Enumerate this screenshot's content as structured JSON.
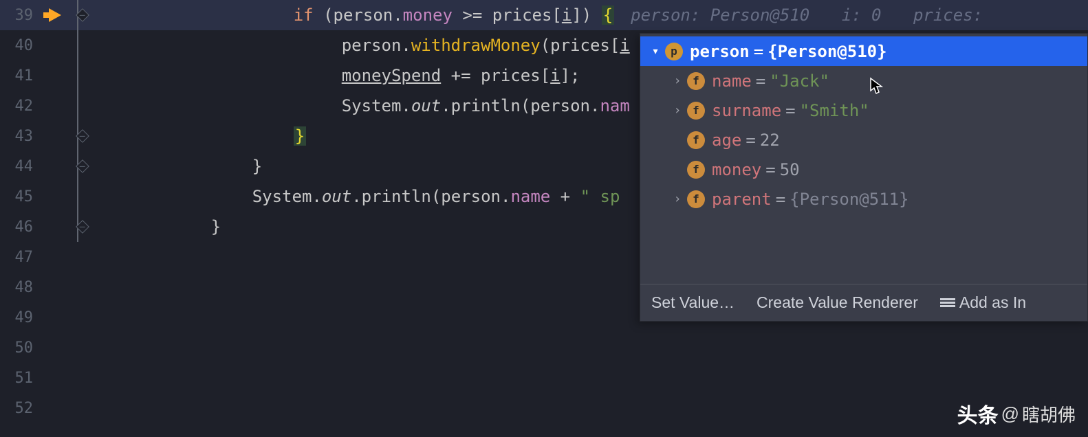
{
  "gutter": {
    "line39": "39",
    "line40": "40",
    "line41": "41",
    "line42": "42",
    "line43": "43",
    "line44": "44",
    "line45": "45",
    "line46": "46",
    "line47": "47",
    "line48": "48",
    "line49": "49",
    "line50": "50",
    "line51": "51",
    "line52": "52"
  },
  "code": {
    "l39_if": "if ",
    "l39_lpar": "(",
    "l39_person": "person",
    "l39_dot": ".",
    "l39_money": "money",
    "l39_op": " >= ",
    "l39_prices": "prices",
    "l39_lb": "[",
    "l39_i": "i",
    "l39_rb": "]) ",
    "l39_brace": "{",
    "l40_person": "person",
    "l40_dot": ".",
    "l40_call": "withdrawMoney",
    "l40_lpar": "(",
    "l40_prices": "prices",
    "l40_lb": "[",
    "l40_i": "i",
    "l41_moneySpend": "moneySpend",
    "l41_op": " += ",
    "l41_prices": "prices",
    "l41_lb": "[",
    "l41_i": "i",
    "l41_rb": "];",
    "l42_system": "System",
    "l42_dot1": ".",
    "l42_out": "out",
    "l42_dot2": ".",
    "l42_println": "println",
    "l42_lpar": "(",
    "l42_person": "person",
    "l42_dot3": ".",
    "l42_nam": "nam",
    "l43_brace": "}",
    "l44_brace": "}",
    "l45_system": "System",
    "l45_dot1": ".",
    "l45_out": "out",
    "l45_dot2": ".",
    "l45_println": "println",
    "l45_lpar": "(",
    "l45_person": "person",
    "l45_dot3": ".",
    "l45_name": "name",
    "l45_plus": " + ",
    "l45_str": "\" sp",
    "l46_brace": "}"
  },
  "inlay": {
    "person_label": "person: ",
    "person_val": "Person@510",
    "i_label": "i: ",
    "i_val": "0",
    "prices_label": "prices:"
  },
  "popup": {
    "root_var": "person",
    "root_val": "{Person@510}",
    "name_var": "name",
    "name_val": "\"Jack\"",
    "surname_var": "surname",
    "surname_val": "\"Smith\"",
    "age_var": "age",
    "age_val": "22",
    "money_var": "money",
    "money_val": "50",
    "parent_var": "parent",
    "parent_val": "{Person@511}",
    "badge_p": "p",
    "badge_f": "f"
  },
  "actions": {
    "set_value": "Set Value…",
    "create_renderer": "Create Value Renderer",
    "add_as": "Add as In"
  },
  "watermark": {
    "brand": "头条",
    "at": "@",
    "author": "瞎胡佛"
  }
}
